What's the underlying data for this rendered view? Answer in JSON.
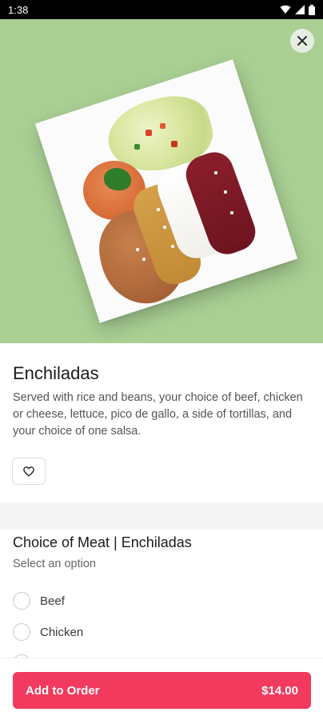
{
  "status_bar": {
    "time": "1:38",
    "icons": [
      "wifi-icon",
      "signal-icon",
      "battery-icon"
    ]
  },
  "item": {
    "title": "Enchiladas",
    "description": "Served with rice and beans, your choice of beef, chicken or cheese, lettuce, pico de gallo, a side of tortillas, and your choice of one salsa."
  },
  "choice": {
    "title": "Choice of Meat | Enchiladas",
    "subtitle": "Select an option",
    "options": [
      {
        "label": "Beef"
      },
      {
        "label": "Chicken"
      }
    ]
  },
  "footer": {
    "button_label": "Add to Order",
    "price": "$14.00"
  },
  "colors": {
    "accent": "#f13a5e",
    "hero_background": "#a9cf93"
  },
  "icons": {
    "close": "close-icon",
    "favorite": "heart-icon"
  }
}
